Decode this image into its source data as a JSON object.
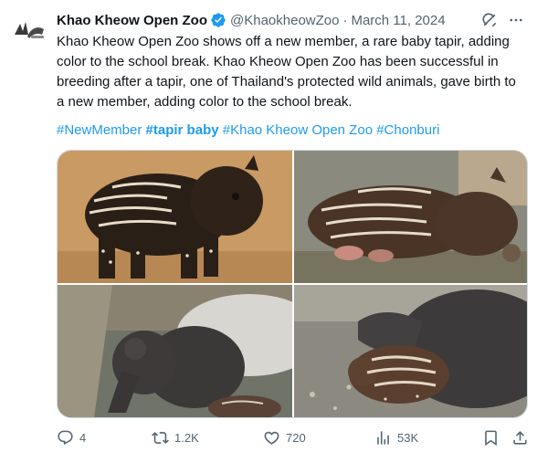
{
  "author": {
    "display_name": "Khao Kheow Open Zoo",
    "handle": "@KhaokheowZoo",
    "date": "March 11, 2024",
    "verified": true,
    "avatar_icon": "zoo-logo-icon"
  },
  "header_icons": {
    "grok": "grok-icon",
    "more": "more-icon"
  },
  "body": {
    "text": "Khao Kheow Open Zoo shows off a new member, a rare baby tapir, adding color to the school break. Khao Kheow Open Zoo has been successful in breeding after a tapir, one of Thailand's protected wild animals, gave birth to a new member, adding color to the school break."
  },
  "hashtags": [
    {
      "text": "#NewMember",
      "bold": false
    },
    {
      "text": "#tapir baby",
      "bold": true
    },
    {
      "text": "#Khao Kheow Open Zoo",
      "bold": false
    },
    {
      "text": "#Chonburi",
      "bold": false
    }
  ],
  "media": [
    {
      "name": "baby-tapir-standing-photo"
    },
    {
      "name": "baby-tapir-lying-photo"
    },
    {
      "name": "adult-tapir-with-baby-in-water-photo"
    },
    {
      "name": "baby-tapir-with-mother-photo"
    }
  ],
  "actions": {
    "reply": "4",
    "retweet": "1.2K",
    "like": "720",
    "views": "53K"
  },
  "colors": {
    "accent": "#1d9bf0",
    "text": "#0f1419",
    "muted": "#536471",
    "border": "#cfd9de"
  }
}
